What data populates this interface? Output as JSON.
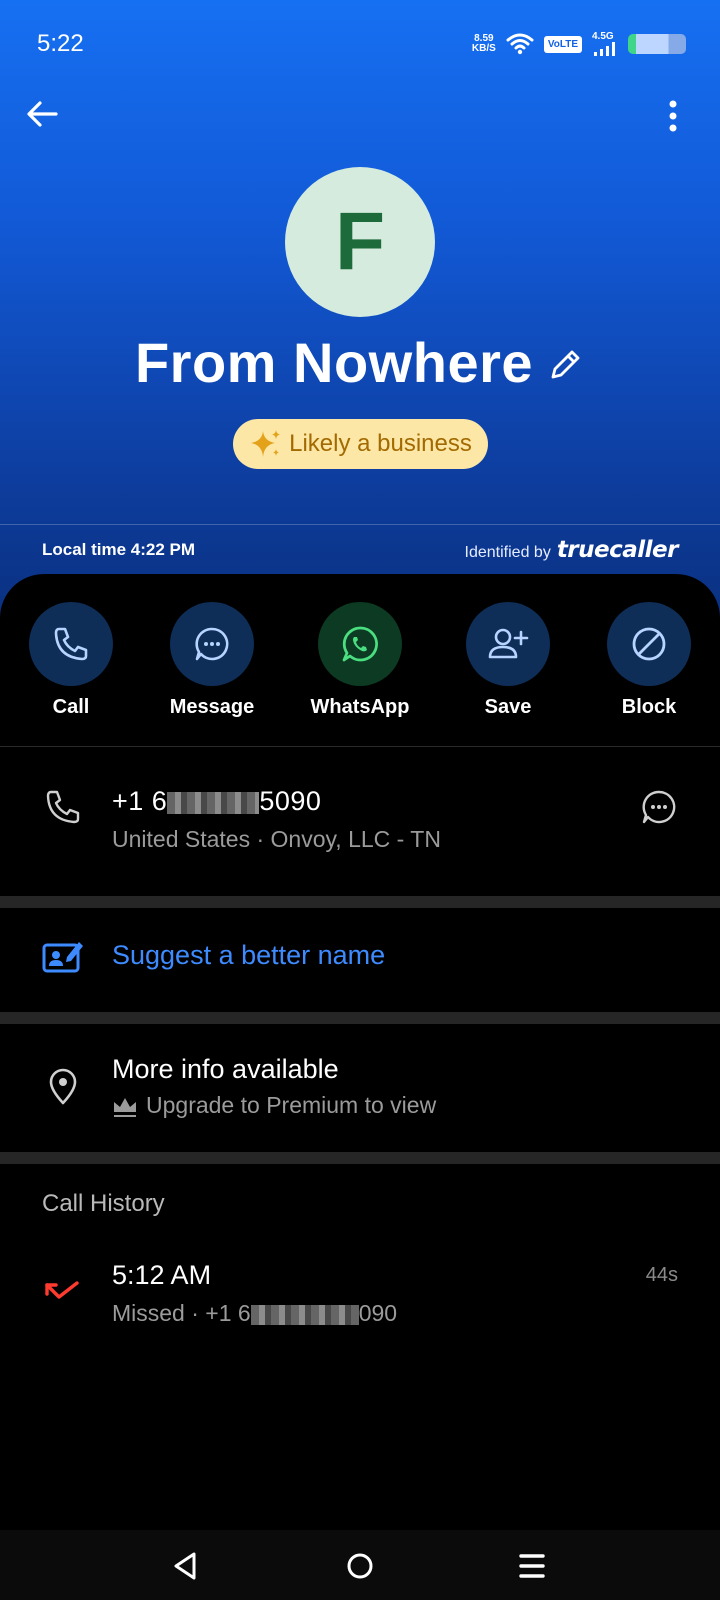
{
  "status_bar": {
    "time": "5:22",
    "net_speed_value": "8.59",
    "net_speed_unit": "KB/S",
    "volte": "VoLTE",
    "network": "4.5G"
  },
  "header": {
    "avatar_letter": "F",
    "name": "From Nowhere",
    "badge": "Likely a business",
    "local_time": "Local time 4:22 PM",
    "identified_by": "Identified by",
    "brand": "truecaller"
  },
  "actions": [
    {
      "label": "Call",
      "icon": "phone-icon"
    },
    {
      "label": "Message",
      "icon": "message-icon"
    },
    {
      "label": "WhatsApp",
      "icon": "whatsapp-icon"
    },
    {
      "label": "Save",
      "icon": "add-person-icon"
    },
    {
      "label": "Block",
      "icon": "block-icon"
    }
  ],
  "phone": {
    "number_prefix": "+1 6",
    "number_suffix": "5090",
    "details": "United States · Onvoy, LLC - TN"
  },
  "suggest": {
    "label": "Suggest a better name"
  },
  "more_info": {
    "title": "More info available",
    "subtitle": "Upgrade to Premium to view"
  },
  "call_history": {
    "title": "Call History",
    "entries": [
      {
        "time": "5:12 AM",
        "type": "Missed",
        "number_prefix": "Missed · +1 6",
        "number_suffix": "090",
        "duration": "44s"
      }
    ]
  },
  "colors": {
    "header_top": "#1670f2",
    "accent_blue": "#3d8bff",
    "missed_red": "#ff3b30",
    "badge_bg": "#fde7a6",
    "avatar_bg": "#d4ebdd"
  }
}
